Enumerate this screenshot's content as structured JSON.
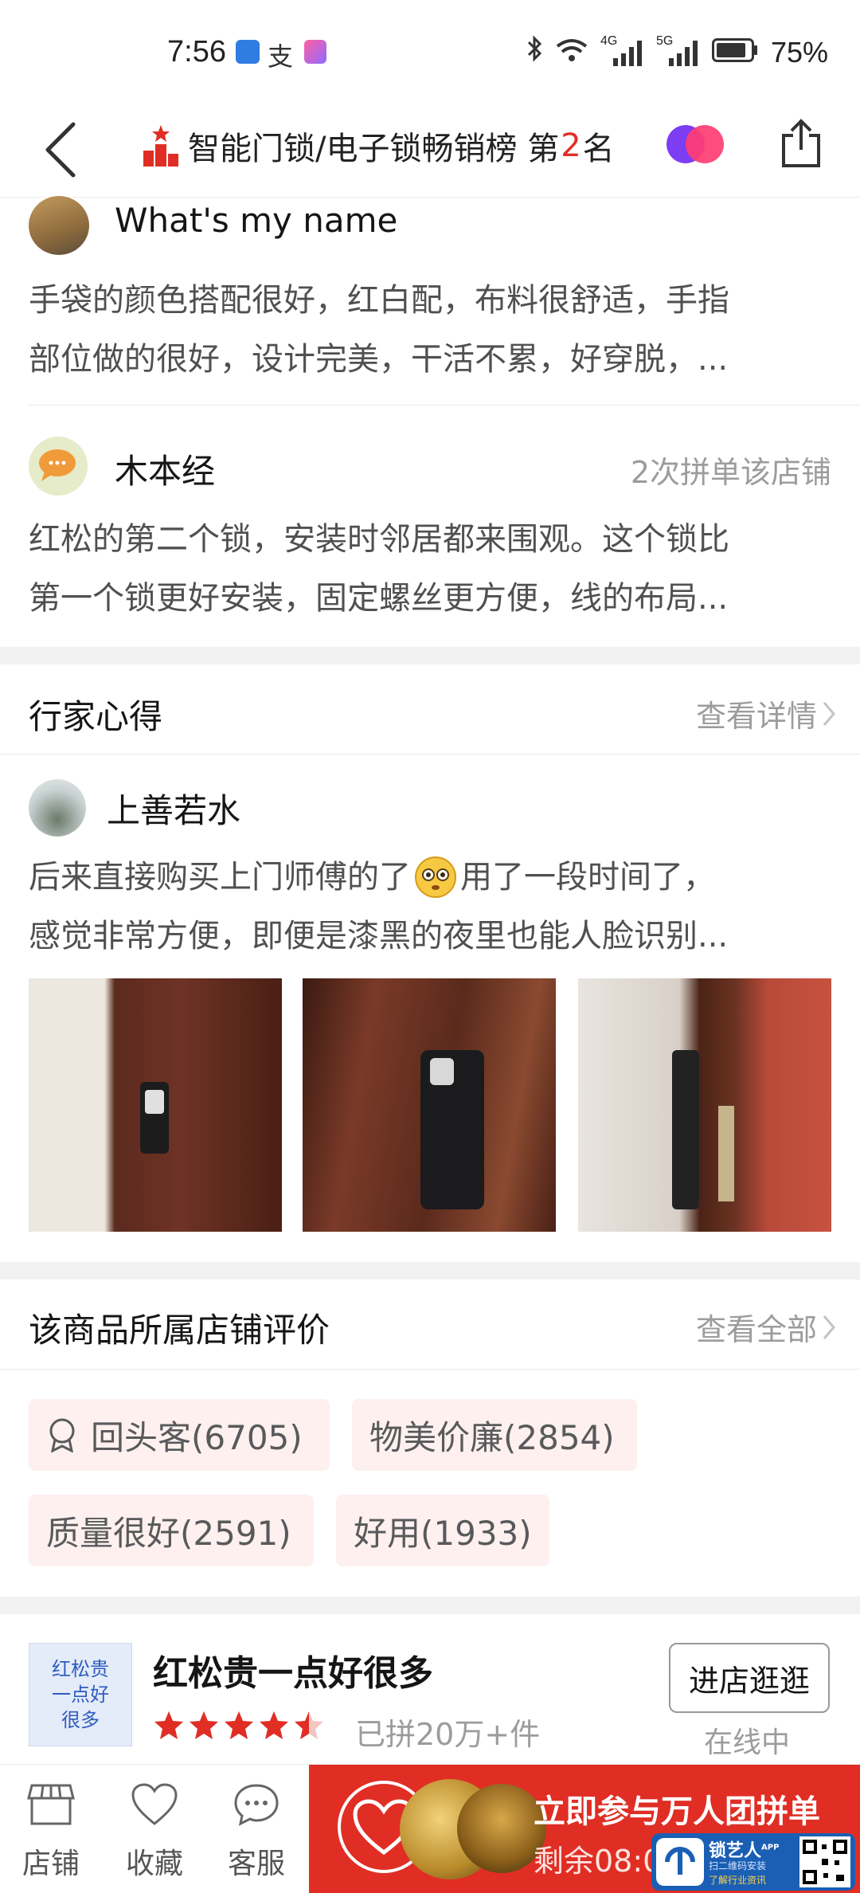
{
  "status_bar": {
    "time": "7:56",
    "battery": "75%",
    "network_1": "4G",
    "network_2": "5G"
  },
  "nav": {
    "rank_text": "智能门锁/电子锁畅销榜 第",
    "rank_number": "2",
    "rank_suffix": "名"
  },
  "reviews": [
    {
      "name": "What's my name",
      "text_line1": "手袋的颜色搭配很好，红白配，布料很舒适，手指",
      "text_line2": "部位做的很好，设计完美，干活不累，好穿脱，..."
    },
    {
      "name": "木本经",
      "badge": "2次拼单该店铺",
      "text_line1": "红松的第二个锁，安装时邻居都来围观。这个锁比",
      "text_line2": "第一个锁更好安装，固定螺丝更方便，线的布局..."
    }
  ],
  "expert": {
    "title": "行家心得",
    "more": "查看详情",
    "name": "上善若水",
    "text_line1a": "后来直接购买上门师傅的了",
    "text_line1b": "用了一段时间了，",
    "text_line2": "感觉非常方便，即便是漆黑的夜里也能人脸识别..."
  },
  "store_reviews": {
    "title": "该商品所属店铺评价",
    "more": "查看全部",
    "tags": [
      "回头客(6705)",
      "物美价廉(2854)",
      "质量很好(2591)",
      "好用(1933)"
    ]
  },
  "store": {
    "logo_text_1": "红松贵",
    "logo_text_2": "一点好",
    "logo_text_3": "很多",
    "name": "红松贵一点好很多",
    "sold": "已拼20万+件",
    "rating": 4.5,
    "enter_button": "进店逛逛",
    "online": "在线中"
  },
  "bottom_bar": {
    "tabs": [
      "店铺",
      "收藏",
      "客服"
    ],
    "cta_title": "立即参与万人团拼单",
    "cta_sub": "剩余08:0",
    "watermark_title": "锁艺人",
    "watermark_app": "APP",
    "watermark_sub1": "扫二维码安装",
    "watermark_sub2": "了解行业资讯"
  },
  "colors": {
    "accent": "#e02e24",
    "tag_bg": "#fdf0ef"
  }
}
